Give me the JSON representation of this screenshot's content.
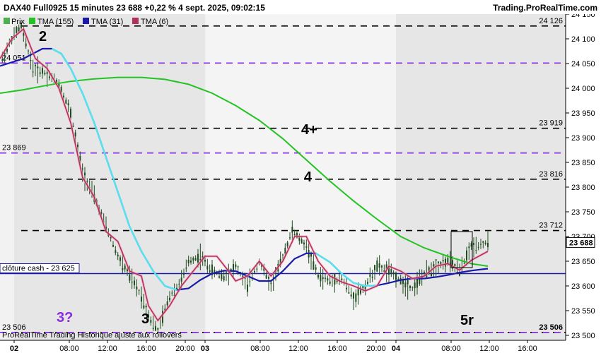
{
  "header": {
    "title": "DAX40 Full0925 15 minutes 23 688 +0,22 % 4 sept. 2025, 09:02:15",
    "brand": "Trading.ProRealTime.com"
  },
  "footer": {
    "note": "ProRealTime Trading  Historique ajusté aux rollovers"
  },
  "legend": [
    {
      "label": "Prix",
      "color": "#4caf50"
    },
    {
      "label": "TMA (155)",
      "color": "#22c322"
    },
    {
      "label": "TMA (31)",
      "color": "#1a1aa8"
    },
    {
      "label": "TMA (6)",
      "color": "#b03060"
    }
  ],
  "colors": {
    "candles": "#1f4d1f",
    "tma155": "#22c322",
    "tma31": "#1a1aa8",
    "tma_light": "#55e3f0",
    "tma6": "#b03060",
    "tma6_glow": "#ff9eb5",
    "black_levels": "#000000",
    "purple_levels": "#8a2be2",
    "cash_line": "#1a1aa8",
    "session_shade": "#e9e9e9"
  },
  "chart_data": {
    "type": "line",
    "title": "DAX40 Full0925 15 minutes",
    "ylim": [
      23490,
      24150
    ],
    "y_ticks": [
      {
        "value": 24150,
        "label": "24 150"
      },
      {
        "value": 24100,
        "label": "24 100"
      },
      {
        "value": 24050,
        "label": "24 050"
      },
      {
        "value": 24000,
        "label": "24 000"
      },
      {
        "value": 23950,
        "label": "23 950"
      },
      {
        "value": 23900,
        "label": "23 900"
      },
      {
        "value": 23850,
        "label": "23 850"
      },
      {
        "value": 23800,
        "label": "23 800"
      },
      {
        "value": 23750,
        "label": "23 750"
      },
      {
        "value": 23700,
        "label": "23 700"
      },
      {
        "value": 23650,
        "label": "23 650"
      },
      {
        "value": 23600,
        "label": "23 600"
      },
      {
        "value": 23550,
        "label": "23 550"
      },
      {
        "value": 23500,
        "label": "23 500"
      }
    ],
    "x_ticks": [
      {
        "label": "02",
        "bold": true
      },
      {
        "label": "08:00",
        "bold": false
      },
      {
        "label": "12:00",
        "bold": false
      },
      {
        "label": "16:00",
        "bold": false
      },
      {
        "label": "20:00",
        "bold": false
      },
      {
        "label": "03",
        "bold": true
      },
      {
        "label": "08:00",
        "bold": false
      },
      {
        "label": "12:00",
        "bold": false
      },
      {
        "label": "16:00",
        "bold": false
      },
      {
        "label": "20:00",
        "bold": false
      },
      {
        "label": "04",
        "bold": true
      },
      {
        "label": "08:00",
        "bold": false
      },
      {
        "label": "12:00",
        "bold": false
      },
      {
        "label": "16:00",
        "bold": false
      }
    ],
    "levels": [
      {
        "value": 24126,
        "style": "black",
        "label": "24 126"
      },
      {
        "value": 23919,
        "style": "black",
        "label": "23 919"
      },
      {
        "value": 23816,
        "style": "black",
        "label": "23 816"
      },
      {
        "value": 23712,
        "style": "black",
        "label": "23 712"
      },
      {
        "value": 23506,
        "style": "black",
        "label": "23 506"
      },
      {
        "value": 24051,
        "style": "purple",
        "label": "24 051"
      },
      {
        "value": 23869,
        "style": "purple",
        "label": "23 869"
      },
      {
        "value": 23506,
        "style": "purple",
        "label": "23 506"
      }
    ],
    "cash_close": {
      "value": 23625,
      "label": "clôture cash -  23 625"
    },
    "last_price": {
      "value": 23688,
      "label": "23 688"
    },
    "annotations": [
      {
        "text": "2",
        "value": 24130
      },
      {
        "text": "4+",
        "value": 23919
      },
      {
        "text": "4",
        "value": 23816
      },
      {
        "text": "3",
        "value": 23503
      },
      {
        "text": "3?",
        "value": 23503
      },
      {
        "text": "5r",
        "value": 23498
      }
    ],
    "series": [
      {
        "name": "TMA (155)",
        "values": [
          [
            0,
            23990
          ],
          [
            10,
            23997
          ],
          [
            20,
            24006
          ],
          [
            30,
            24014
          ],
          [
            40,
            24019
          ],
          [
            50,
            24022
          ],
          [
            60,
            24022
          ],
          [
            70,
            24018
          ],
          [
            80,
            24008
          ],
          [
            90,
            23990
          ],
          [
            100,
            23965
          ],
          [
            110,
            23935
          ],
          [
            120,
            23898
          ],
          [
            130,
            23855
          ],
          [
            140,
            23812
          ],
          [
            150,
            23772
          ],
          [
            160,
            23735
          ],
          [
            170,
            23700
          ],
          [
            180,
            23677
          ],
          [
            190,
            23660
          ],
          [
            200,
            23645
          ],
          [
            207,
            23640
          ]
        ]
      },
      {
        "name": "TMA (31)",
        "values": [
          [
            0,
            24045
          ],
          [
            10,
            24060
          ],
          [
            18,
            24080
          ],
          [
            22,
            24080
          ],
          [
            26,
            24070
          ],
          [
            30,
            24040
          ],
          [
            35,
            23990
          ],
          [
            40,
            23930
          ],
          [
            45,
            23860
          ],
          [
            50,
            23790
          ],
          [
            55,
            23720
          ],
          [
            60,
            23670
          ],
          [
            65,
            23630
          ],
          [
            70,
            23600
          ],
          [
            75,
            23592
          ],
          [
            80,
            23595
          ],
          [
            85,
            23612
          ],
          [
            90,
            23625
          ],
          [
            95,
            23631
          ],
          [
            100,
            23630
          ],
          [
            105,
            23620
          ],
          [
            110,
            23610
          ],
          [
            115,
            23610
          ],
          [
            120,
            23630
          ],
          [
            125,
            23655
          ],
          [
            130,
            23666
          ],
          [
            134,
            23666
          ],
          [
            140,
            23648
          ],
          [
            145,
            23625
          ],
          [
            150,
            23606
          ],
          [
            155,
            23600
          ],
          [
            160,
            23601
          ],
          [
            165,
            23606
          ],
          [
            170,
            23612
          ],
          [
            175,
            23615
          ],
          [
            180,
            23615
          ],
          [
            185,
            23618
          ],
          [
            190,
            23622
          ],
          [
            195,
            23627
          ],
          [
            200,
            23631
          ],
          [
            207,
            23635
          ]
        ]
      },
      {
        "name": "TMA (6)",
        "values": [
          [
            0,
            24060
          ],
          [
            5,
            24100
          ],
          [
            10,
            24120
          ],
          [
            15,
            24060
          ],
          [
            20,
            24040
          ],
          [
            25,
            24000
          ],
          [
            30,
            23930
          ],
          [
            35,
            23820
          ],
          [
            40,
            23780
          ],
          [
            45,
            23710
          ],
          [
            50,
            23690
          ],
          [
            55,
            23630
          ],
          [
            60,
            23620
          ],
          [
            63,
            23560
          ],
          [
            67,
            23530
          ],
          [
            72,
            23560
          ],
          [
            77,
            23600
          ],
          [
            82,
            23630
          ],
          [
            87,
            23660
          ],
          [
            92,
            23660
          ],
          [
            97,
            23630
          ],
          [
            100,
            23610
          ],
          [
            105,
            23620
          ],
          [
            110,
            23650
          ],
          [
            115,
            23620
          ],
          [
            120,
            23650
          ],
          [
            125,
            23700
          ],
          [
            130,
            23700
          ],
          [
            135,
            23650
          ],
          [
            140,
            23620
          ],
          [
            145,
            23608
          ],
          [
            150,
            23600
          ],
          [
            155,
            23590
          ],
          [
            160,
            23600
          ],
          [
            165,
            23640
          ],
          [
            170,
            23630
          ],
          [
            175,
            23615
          ],
          [
            180,
            23620
          ],
          [
            185,
            23640
          ],
          [
            190,
            23645
          ],
          [
            195,
            23632
          ],
          [
            200,
            23652
          ],
          [
            207,
            23670
          ]
        ]
      },
      {
        "name": "Prix",
        "values": [
          [
            0,
            24050
          ],
          [
            5,
            24100
          ],
          [
            9,
            24126
          ],
          [
            14,
            24040
          ],
          [
            20,
            24030
          ],
          [
            25,
            24010
          ],
          [
            30,
            23950
          ],
          [
            35,
            23830
          ],
          [
            40,
            23780
          ],
          [
            45,
            23720
          ],
          [
            50,
            23660
          ],
          [
            55,
            23620
          ],
          [
            60,
            23580
          ],
          [
            64,
            23530
          ],
          [
            67,
            23510
          ],
          [
            72,
            23580
          ],
          [
            77,
            23610
          ],
          [
            80,
            23650
          ],
          [
            85,
            23660
          ],
          [
            90,
            23630
          ],
          [
            95,
            23620
          ],
          [
            100,
            23640
          ],
          [
            105,
            23600
          ],
          [
            110,
            23650
          ],
          [
            115,
            23600
          ],
          [
            120,
            23660
          ],
          [
            124,
            23712
          ],
          [
            130,
            23680
          ],
          [
            135,
            23620
          ],
          [
            140,
            23610
          ],
          [
            145,
            23615
          ],
          [
            150,
            23575
          ],
          [
            155,
            23600
          ],
          [
            160,
            23640
          ],
          [
            165,
            23630
          ],
          [
            170,
            23610
          ],
          [
            175,
            23595
          ],
          [
            180,
            23625
          ],
          [
            185,
            23640
          ],
          [
            190,
            23650
          ],
          [
            195,
            23630
          ],
          [
            200,
            23680
          ],
          [
            207,
            23688
          ]
        ]
      }
    ]
  }
}
